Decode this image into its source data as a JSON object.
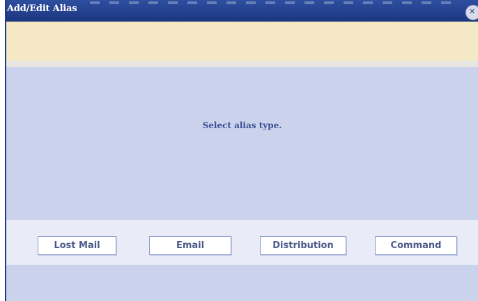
{
  "window": {
    "title": "Add/Edit Alias",
    "close_icon": "close-icon"
  },
  "message": {
    "text": ""
  },
  "prompt": {
    "text": "Select alias type."
  },
  "buttons": [
    {
      "label": "Lost Mail"
    },
    {
      "label": "Email"
    },
    {
      "label": "Distribution"
    },
    {
      "label": "Command"
    }
  ],
  "colors": {
    "titlebar": "#1e3a8a",
    "body": "#cbd3ec",
    "message_bar": "#f5e8c4",
    "button_row": "#e9ecf6",
    "button_text": "#4d5a89",
    "prompt_text": "#3a4e93"
  }
}
